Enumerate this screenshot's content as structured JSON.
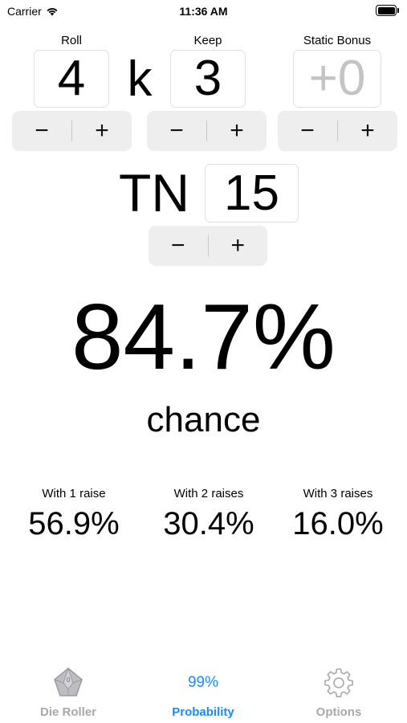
{
  "status": {
    "carrier": "Carrier",
    "time": "11:36 AM"
  },
  "roll": {
    "label": "Roll",
    "value": "4"
  },
  "separator": "k",
  "keep": {
    "label": "Keep",
    "value": "3"
  },
  "bonus": {
    "label": "Static Bonus",
    "placeholder": "+0"
  },
  "stepper": {
    "minus": "−",
    "plus": "+"
  },
  "tn": {
    "label": "TN",
    "value": "15"
  },
  "result": {
    "percent": "84.7%",
    "caption": "chance"
  },
  "raises": [
    {
      "label": "With 1 raise",
      "value": "56.9%"
    },
    {
      "label": "With 2 raises",
      "value": "30.4%"
    },
    {
      "label": "With 3 raises",
      "value": "16.0%"
    }
  ],
  "tabs": [
    {
      "label": "Die Roller",
      "icon": "d10-die-icon"
    },
    {
      "label": "Probability",
      "icon_text": "99%",
      "active": true
    },
    {
      "label": "Options",
      "icon": "gear-icon"
    }
  ],
  "colors": {
    "accent": "#1a8cff",
    "inactive": "#a9a9ad",
    "stepper_bg": "#eeeeef",
    "placeholder": "#c4c4c4"
  }
}
